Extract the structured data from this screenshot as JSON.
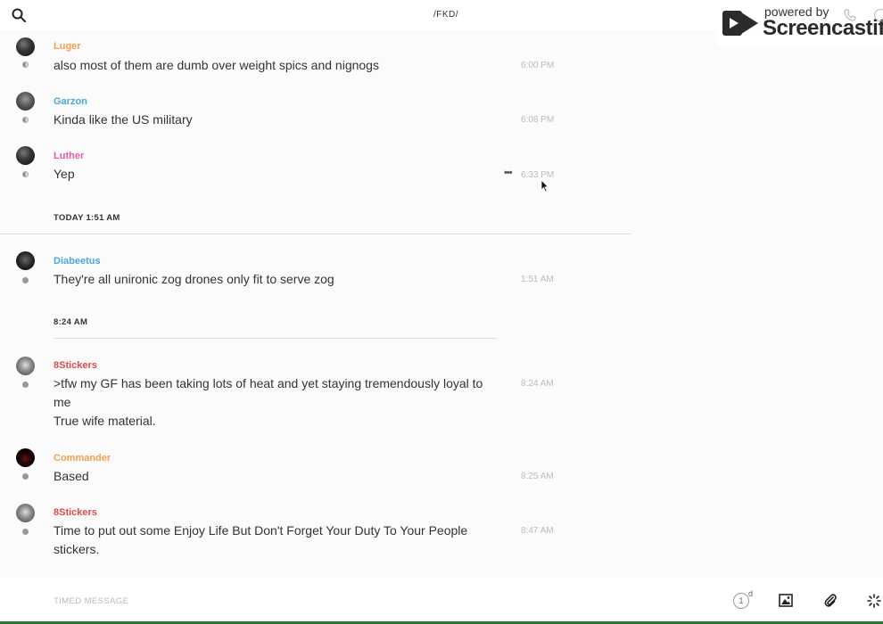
{
  "header": {
    "channel_title": "/FKD/"
  },
  "watermark": {
    "powered_by": "powered by",
    "brand": "Screencastify"
  },
  "messages": [
    {
      "user": "Luger",
      "color": "#f0a04b",
      "text": "also most of them are dumb over weight spics and nignogs",
      "time": "6:00 PM"
    },
    {
      "user": "Garzon",
      "color": "#4aa8d8",
      "text": "Kinda like the US military",
      "time": "6:08 PM"
    },
    {
      "user": "Luther",
      "color": "#e05ca8",
      "text": "Yep",
      "time": "6:33 PM"
    },
    {
      "user": "Diabeetus",
      "color": "#4aa8d8",
      "text": "They're all unironic zog drones only fit to serve zog",
      "time": "1:51 AM"
    },
    {
      "user": "8Stickers",
      "color": "#e04a4a",
      "text": ">tfw my GF has been taking lots of heat and yet staying tremendously loyal to me",
      "text2": "True wife material.",
      "time": "8:24 AM"
    },
    {
      "user": "Commander",
      "color": "#f0a04b",
      "text": "Based",
      "time": "8:25 AM"
    },
    {
      "user": "8Stickers",
      "color": "#e04a4a",
      "text": "Time to put out some Enjoy Life But Don't Forget Your Duty To Your People stickers.",
      "time": "8:47 AM"
    }
  ],
  "dividers": {
    "today": "TODAY 1:51 AM",
    "later": "8:24 AM"
  },
  "message_actions": {
    "more_label": "•••"
  },
  "composer": {
    "placeholder": "TIMED MESSAGE",
    "timer_value": "1",
    "timer_unit": "d"
  },
  "icons": [
    "search-icon",
    "more-icon",
    "cursor-icon",
    "timer-icon",
    "image-icon",
    "paperclip-icon",
    "send-icon",
    "phone-icon",
    "info-icon"
  ]
}
